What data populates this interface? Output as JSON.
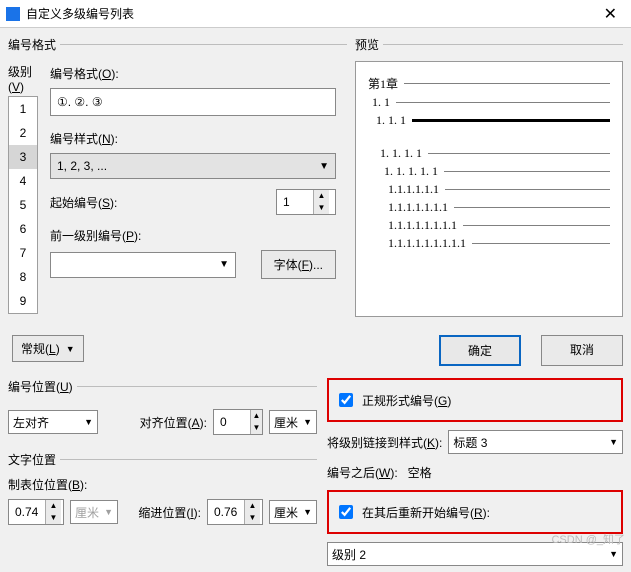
{
  "title": "自定义多级编号列表",
  "sections": {
    "number_format": "编号格式",
    "preview": "预览",
    "level_label": "级别(V)",
    "number_position": "编号位置(U)",
    "text_position": "文字位置"
  },
  "levels": {
    "items": [
      "1",
      "2",
      "3",
      "4",
      "5",
      "6",
      "7",
      "8",
      "9"
    ],
    "selected": "3"
  },
  "format": {
    "number_format_label": "编号格式(O):",
    "number_format_value": "①. ②. ③",
    "number_style_label": "编号样式(N):",
    "number_style_value": "1, 2, 3, ...",
    "start_at_label": "起始编号(S):",
    "start_at_value": "1",
    "prev_level_label": "前一级别编号(P):",
    "prev_level_value": "",
    "font_button": "字体(F)..."
  },
  "preview_lines": [
    {
      "num": "第1章",
      "bold": false
    },
    {
      "num": "1. 1",
      "bold": false
    },
    {
      "num": "1. 1. 1",
      "bold": true
    },
    {
      "num": "1. 1. 1. 1",
      "bold": false
    },
    {
      "num": "1. 1. 1. 1. 1",
      "bold": false
    },
    {
      "num": "1.1.1.1.1.1",
      "bold": false
    },
    {
      "num": "1.1.1.1.1.1.1",
      "bold": false
    },
    {
      "num": "1.1.1.1.1.1.1.1",
      "bold": false
    },
    {
      "num": "1.1.1.1.1.1.1.1.1",
      "bold": false
    }
  ],
  "changgui_button": "常规(L)",
  "ok_button": "确定",
  "cancel_button": "取消",
  "num_pos": {
    "align_value": "左对齐",
    "align_at_label": "对齐位置(A):",
    "align_at_value": "0",
    "unit": "厘米"
  },
  "text_pos": {
    "tab_label": "制表位位置(B):",
    "tab_value": "0.74",
    "tab_unit": "厘米",
    "indent_label": "缩进位置(I):",
    "indent_value": "0.76",
    "indent_unit": "厘米"
  },
  "right": {
    "legal_checkbox_label": "正规形式编号(G)",
    "link_style_label": "将级别链接到样式(K):",
    "link_style_value": "标题 3",
    "follow_label": "编号之后(W):",
    "follow_value": "空格",
    "restart_checkbox_label": "在其后重新开始编号(R):",
    "restart_level_value": "级别 2"
  },
  "watermark": "CSDN @_知了"
}
